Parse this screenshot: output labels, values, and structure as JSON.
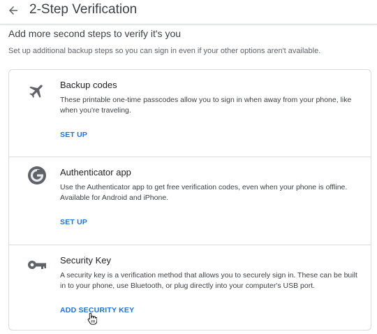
{
  "header": {
    "title": "2-Step Verification",
    "back_icon": "arrow-back-icon"
  },
  "intro": {
    "heading": "Add more second steps to verify it's you",
    "subheading": "Set up additional backup steps so you can sign in even if your other options aren't available."
  },
  "options": [
    {
      "icon": "airplane-icon",
      "title": "Backup codes",
      "description": "These printable one-time passcodes allow you to sign in when away from your phone, like when you're traveling.",
      "action": "SET UP"
    },
    {
      "icon": "authenticator-app-icon",
      "title": "Authenticator app",
      "description": "Use the Authenticator app to get free verification codes, even when your phone is offline. Available for Android and iPhone.",
      "action": "SET UP"
    },
    {
      "icon": "key-icon",
      "title": "Security Key",
      "description": "A security key is a verification method that allows you to securely sign in. These can be built in to your phone, use Bluetooth, or plug directly into your computer's USB port.",
      "action": "ADD SECURITY KEY"
    }
  ],
  "colors": {
    "accent": "#1a73e8",
    "icon": "#5f6368",
    "divider": "#dadce0"
  }
}
